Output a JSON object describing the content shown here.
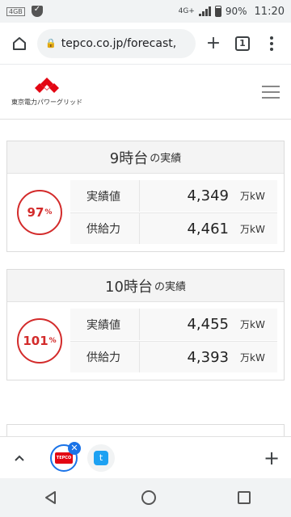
{
  "status_bar": {
    "left_badge": "4GB",
    "network_label": "4G+",
    "battery": "90%",
    "time": "11:20"
  },
  "browser": {
    "url": "tepco.co.jp/forecast,",
    "tab_count": "1"
  },
  "site": {
    "logo_text": "東京電力パワーグリッド",
    "brand_color": "#e30613"
  },
  "cards": [
    {
      "hour": "9時台",
      "suffix": "の実績",
      "usage_rate": "97",
      "usage_unit": "%",
      "rows": [
        {
          "label": "実績値",
          "value": "4,349",
          "unit": "万kW"
        },
        {
          "label": "供給力",
          "value": "4,461",
          "unit": "万kW"
        }
      ]
    },
    {
      "hour": "10時台",
      "suffix": "の実績",
      "usage_rate": "101",
      "usage_unit": "%",
      "rows": [
        {
          "label": "実績値",
          "value": "4,455",
          "unit": "万kW"
        },
        {
          "label": "供給力",
          "value": "4,393",
          "unit": "万kW"
        }
      ]
    }
  ],
  "tab_strip": {
    "tepco_favicon_text": "TEPCO",
    "twitter_icon": "t"
  },
  "colors": {
    "accent_red": "#d32b2b",
    "chrome_blue": "#1a73e8"
  }
}
